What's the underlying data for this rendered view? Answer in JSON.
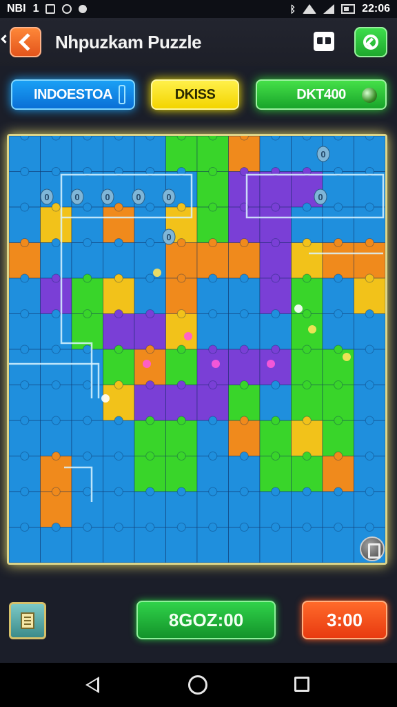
{
  "status_bar": {
    "left_text": "NBI",
    "left_number": "1",
    "time": "22:06",
    "icons": [
      "image-icon",
      "shield-icon",
      "dot-icon",
      "bluetooth-icon",
      "wifi-icon",
      "signal-icon",
      "battery-icon"
    ]
  },
  "header": {
    "title": "Nhpuzkam Puzzle",
    "back_icon": "chevron-left-icon",
    "gift_icon": "gift-icon",
    "share_icon": "share-icon"
  },
  "stats": {
    "blue_label": "INDOESTOA",
    "yellow_label": "DKISS",
    "green_label": "DKT400"
  },
  "board": {
    "columns": 12,
    "rows": 12,
    "tile_colors": [
      [
        "b",
        "b",
        "b",
        "b",
        "b",
        "g",
        "g",
        "o",
        "b",
        "b",
        "b",
        "b"
      ],
      [
        "b",
        "b",
        "b",
        "b",
        "b",
        "b",
        "g",
        "p",
        "p",
        "p",
        "b",
        "b"
      ],
      [
        "b",
        "y",
        "b",
        "o",
        "b",
        "y",
        "g",
        "p",
        "p",
        "b",
        "b",
        "b"
      ],
      [
        "o",
        "b",
        "b",
        "b",
        "b",
        "o",
        "o",
        "o",
        "p",
        "y",
        "o",
        "o"
      ],
      [
        "b",
        "p",
        "g",
        "y",
        "b",
        "o",
        "b",
        "b",
        "p",
        "g",
        "b",
        "y"
      ],
      [
        "b",
        "b",
        "g",
        "p",
        "p",
        "y",
        "b",
        "b",
        "b",
        "g",
        "b",
        "b"
      ],
      [
        "b",
        "b",
        "b",
        "g",
        "o",
        "g",
        "p",
        "p",
        "p",
        "g",
        "g",
        "b"
      ],
      [
        "b",
        "b",
        "b",
        "y",
        "p",
        "p",
        "p",
        "g",
        "b",
        "g",
        "g",
        "b"
      ],
      [
        "b",
        "b",
        "b",
        "b",
        "g",
        "g",
        "b",
        "o",
        "g",
        "y",
        "g",
        "b"
      ],
      [
        "b",
        "o",
        "b",
        "b",
        "g",
        "g",
        "b",
        "b",
        "g",
        "g",
        "o",
        "b"
      ],
      [
        "b",
        "o",
        "b",
        "b",
        "b",
        "b",
        "b",
        "b",
        "b",
        "b",
        "b",
        "b"
      ],
      [
        "b",
        "b",
        "b",
        "b",
        "b",
        "b",
        "b",
        "b",
        "b",
        "b",
        "b",
        "b"
      ]
    ],
    "palette": {
      "b": "#1f8fdd",
      "g": "#39d52a",
      "o": "#f08a1c",
      "y": "#f2c21a",
      "p": "#7a3fd6"
    },
    "glow_color": "#d9f4ff",
    "bead_marker": "0",
    "hint_icon": "hint-icon"
  },
  "footer": {
    "menu_icon": "document-icon",
    "score": "8GOZ:00",
    "timer": "3:00"
  },
  "nav": {
    "back_icon": "nav-back-icon",
    "home_icon": "nav-home-icon",
    "recent_icon": "nav-recent-icon"
  }
}
